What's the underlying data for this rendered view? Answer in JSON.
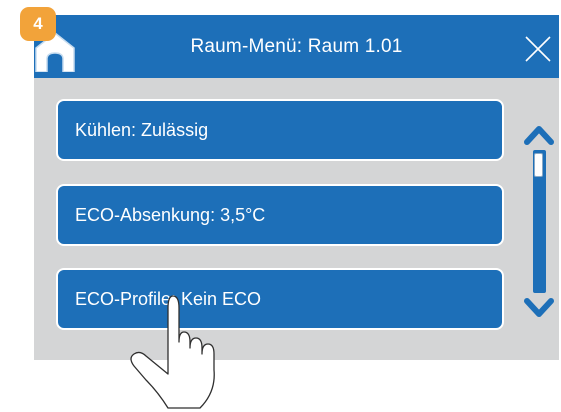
{
  "step": {
    "number": "4",
    "color": "#f2a33a"
  },
  "header": {
    "title": "Raum-Menü: Raum 1.01",
    "background": "#1d6fb8",
    "home_icon": "home-icon",
    "close_icon": "close-icon"
  },
  "menu": {
    "items": [
      {
        "label": "Kühlen: Zulässig"
      },
      {
        "label": "ECO-Absenkung: 3,5°C"
      },
      {
        "label": "ECO-Profile: Kein ECO"
      }
    ]
  },
  "scrollbar": {
    "up_icon": "chevron-up-icon",
    "down_icon": "chevron-down-icon",
    "position": 0
  },
  "overlay": {
    "icon": "pointing-hand-icon"
  }
}
